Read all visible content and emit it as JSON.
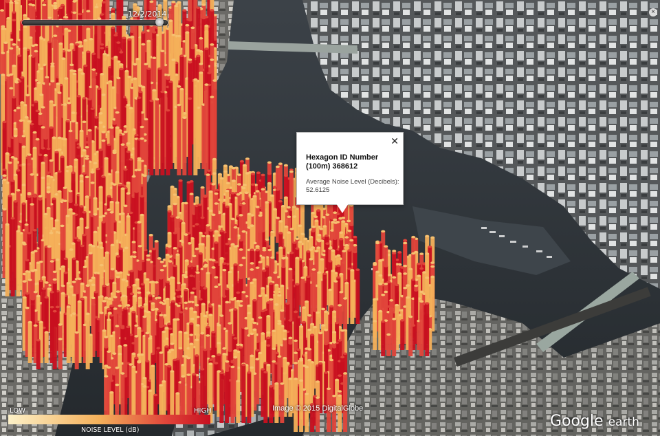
{
  "map": {
    "date": "12/2/2014",
    "time_slider_position": 0.97,
    "attribution": "Image © 2015 DigitalGlobe",
    "logo_main": "Google",
    "logo_sub": "earth"
  },
  "popup": {
    "title": "Hexagon ID Number (100m) 368612",
    "body": "Average Noise Level (Decibels): 52.6125",
    "close": "✕"
  },
  "legend": {
    "low": "LOW",
    "high": "HIGH",
    "title": "NOISE LEVEL (dB)",
    "colors": [
      "#fdf1c8",
      "#f4b05a",
      "#e0453a",
      "#c81020"
    ]
  }
}
